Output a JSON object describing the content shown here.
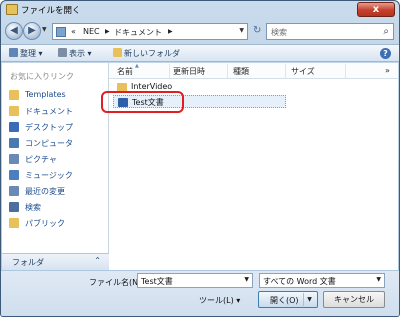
{
  "window": {
    "title": "ファイルを開く",
    "close_label": "x"
  },
  "address": {
    "breadcrumbs": [
      "«",
      "NEC",
      "ドキュメント"
    ],
    "search_placeholder": "検索"
  },
  "toolbar": {
    "organize": "整理",
    "view": "表示",
    "new_folder": "新しいフォルダ",
    "help": "?"
  },
  "sidebar": {
    "header": "お気に入りリンク",
    "items": [
      {
        "label": "Templates",
        "icon": "folder-icon",
        "color": "#e8c15d"
      },
      {
        "label": "ドキュメント",
        "icon": "documents-icon",
        "color": "#e8c15d"
      },
      {
        "label": "デスクトップ",
        "icon": "desktop-icon",
        "color": "#3a6db3"
      },
      {
        "label": "コンピュータ",
        "icon": "computer-icon",
        "color": "#4a78b0"
      },
      {
        "label": "ピクチャ",
        "icon": "pictures-icon",
        "color": "#6a8ab5"
      },
      {
        "label": "ミュージック",
        "icon": "music-icon",
        "color": "#4b7fc0"
      },
      {
        "label": "最近の変更",
        "icon": "recent-icon",
        "color": "#6a8ab5"
      },
      {
        "label": "検索",
        "icon": "search-icon",
        "color": "#4b6e9c"
      },
      {
        "label": "パブリック",
        "icon": "public-folder-icon",
        "color": "#e8c15d"
      }
    ],
    "folder_bar": "フォルダ"
  },
  "filelist": {
    "columns": [
      "名前",
      "更新日時",
      "種類",
      "サイズ"
    ],
    "more": "»",
    "files": [
      {
        "name": "InterVideo",
        "icon": "folder-icon",
        "color": "#e8c15d"
      },
      {
        "name": "Test文書",
        "icon": "word-document-icon",
        "color": "#2f5fa8",
        "selected": true
      }
    ]
  },
  "bottom": {
    "filename_label": "ファイル名(N):",
    "filename_value": "Test文書",
    "filetype_value": "すべての Word 文書",
    "tools": "ツール(L)",
    "open": "開く(O)",
    "cancel": "キャンセル"
  }
}
